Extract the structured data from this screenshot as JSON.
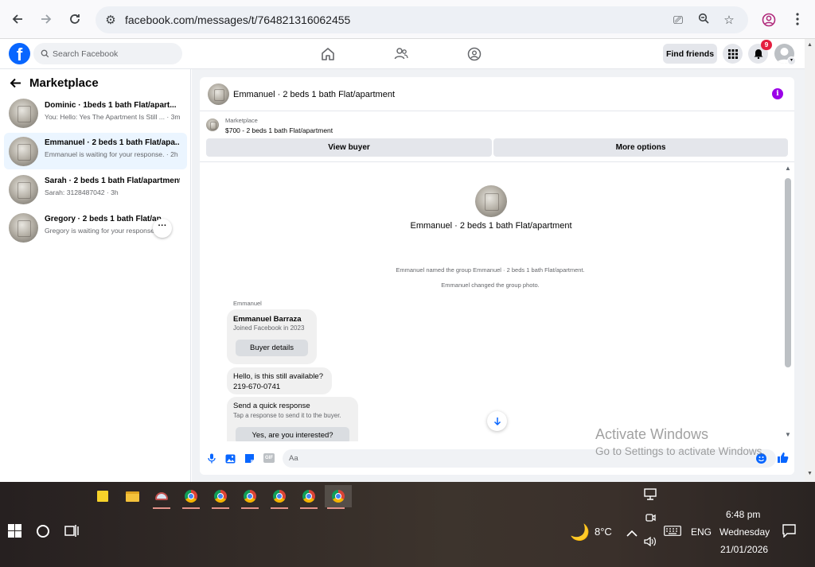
{
  "browser": {
    "url": "facebook.com/messages/t/764821316062455"
  },
  "fb": {
    "logo": "f",
    "search_placeholder": "Search Facebook",
    "find_friends": "Find friends",
    "notification_count": "9"
  },
  "sidebar": {
    "title": "Marketplace",
    "conversations": [
      {
        "name": "Dominic · 1beds 1 bath Flat/apart...",
        "preview": "You: Hello: Yes The Apartment Is Still ... · 3m"
      },
      {
        "name": "Emmanuel · 2 beds 1 bath Flat/apa...",
        "preview": "Emmanuel is waiting for your response. · 2h"
      },
      {
        "name": "Sarah · 2 beds 1 bath Flat/apartment",
        "preview": "Sarah: 3128487042 · 3h"
      },
      {
        "name": "Gregory · 2 beds 1 bath Flat/ap...",
        "preview": "Gregory is waiting for your response..."
      }
    ]
  },
  "chat": {
    "header_title": "Emmanuel · 2 beds 1 bath Flat/apartment",
    "listing_label": "Marketplace",
    "listing_title": "$700 - 2 beds 1 bath Flat/apartment",
    "view_buyer": "View buyer",
    "more_options": "More options",
    "group_name": "Emmanuel · 2 beds 1 bath Flat/apartment",
    "system_msg_1": "Emmanuel named the group Emmanuel · 2 beds 1 bath Flat/apartment.",
    "system_msg_2": "Emmanuel changed the group photo.",
    "sender": "Emmanuel",
    "card_name": "Emmanuel Barraza",
    "card_joined": "Joined Facebook in 2023",
    "buyer_details": "Buyer details",
    "msg_line_1": "Hello, is this still available?",
    "msg_line_2": "219-670-0741",
    "quick_title": "Send a quick response",
    "quick_sub": "Tap a response to send it to the buyer.",
    "quick_option": "Yes, are you interested?",
    "composer_placeholder": "Aa"
  },
  "watermark": {
    "line1": "Activate Windows",
    "line2": "Go to Settings to activate Windows."
  },
  "taskbar": {
    "temperature": "8°C",
    "language": "ENG",
    "time": "6:48 pm",
    "day": "Wednesday",
    "date": "21/01/2026"
  }
}
